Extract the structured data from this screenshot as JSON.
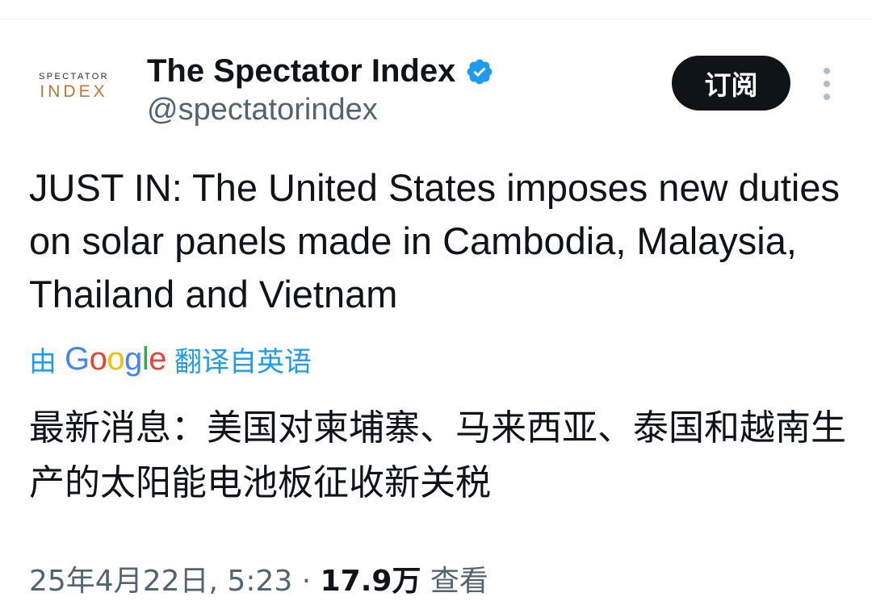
{
  "account": {
    "avatar_top": "SPECTATOR",
    "avatar_bottom": "INDEX",
    "display_name": "The Spectator Index",
    "handle": "@spectatorindex",
    "verified_icon": "verified-badge-icon",
    "verified_color": "#1d9bf0"
  },
  "actions": {
    "subscribe_label": "订阅",
    "more_icon": "more-vertical-icon"
  },
  "tweet": {
    "text": "JUST IN: The United States imposes new duties on solar panels made in Cambodia, Malaysia, Thailand and Vietnam"
  },
  "translation": {
    "by": "由",
    "provider_letters": [
      "G",
      "o",
      "o",
      "g",
      "l",
      "e"
    ],
    "label": "翻译自英语",
    "text": "最新消息：美国对柬埔寨、马来西亚、泰国和越南生产的太阳能电池板征收新关税"
  },
  "meta": {
    "date": "25年4月22日",
    "time": "5:23",
    "separator": "·",
    "views_count": "17.9万",
    "views_label": "查看"
  },
  "colors": {
    "text": "#0f1419",
    "secondary": "#536471",
    "link": "#1d9bf0",
    "button_bg": "#0f1419",
    "avatar_accent": "#b97a2f"
  }
}
